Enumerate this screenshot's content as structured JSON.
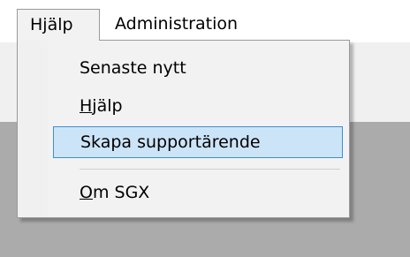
{
  "menubar": {
    "help_menu_label": "Hjälp",
    "admin_menu_label": "Administration"
  },
  "help_menu": {
    "items": [
      {
        "label": "Senaste nytt",
        "mnemonic": "",
        "rest": ""
      },
      {
        "label": "Hjälp",
        "mnemonic": "H",
        "rest": "jälp"
      },
      {
        "label": "Skapa supportärende",
        "mnemonic": "",
        "rest": ""
      },
      {
        "label": "Om SGX",
        "mnemonic": "O",
        "rest": "m SGX"
      }
    ],
    "highlighted_item": "Skapa supportärende"
  },
  "colors": {
    "highlight_fill": "#cce4f7",
    "highlight_border": "#3c8fd4",
    "menu_background": "#f2f2f2",
    "client_area": "#ababab"
  }
}
